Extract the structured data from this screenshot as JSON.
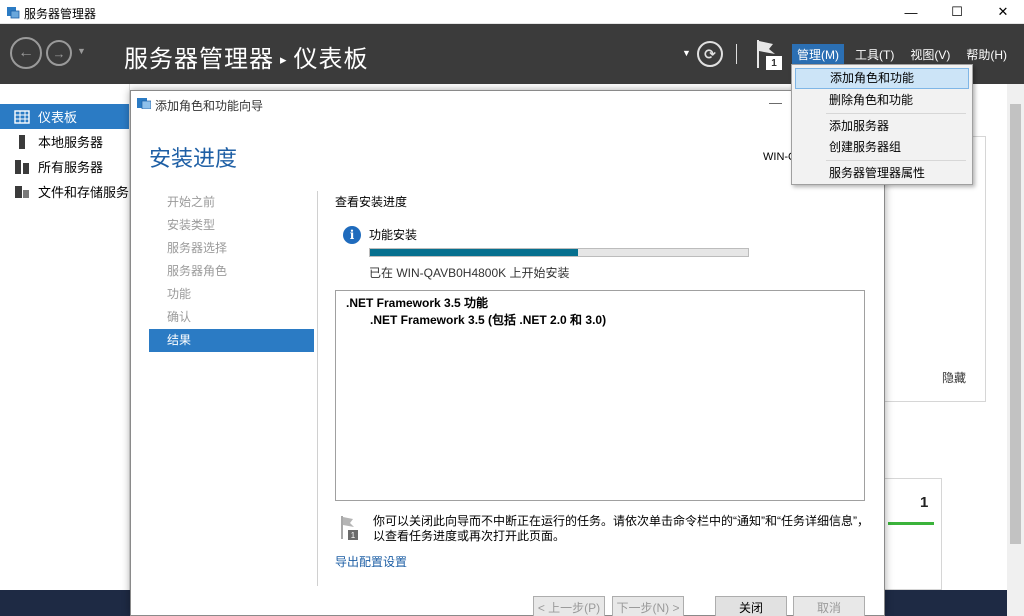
{
  "window": {
    "title": "服务器管理器",
    "minimize_glyph": "—",
    "maximize_glyph": "☐",
    "close_glyph": "✕"
  },
  "header": {
    "breadcrumb_root": "服务器管理器",
    "breadcrumb_sep": "▸",
    "breadcrumb_page": "仪表板",
    "flag_badge": "1",
    "menus": [
      {
        "label": "管理(M)",
        "active": true
      },
      {
        "label": "工具(T)",
        "active": false
      },
      {
        "label": "视图(V)",
        "active": false
      },
      {
        "label": "帮助(H)",
        "active": false
      }
    ]
  },
  "sidebar": {
    "items": [
      {
        "label": "仪表板",
        "icon": "dashboard-icon",
        "selected": true
      },
      {
        "label": "本地服务器",
        "icon": "server-icon",
        "selected": false
      },
      {
        "label": "所有服务器",
        "icon": "servers-icon",
        "selected": false
      },
      {
        "label": "文件和存储服务",
        "icon": "storage-icon",
        "selected": false
      }
    ]
  },
  "background": {
    "hide_label": "隐藏",
    "tile_count": "1"
  },
  "dropdown": {
    "items": [
      {
        "label": "添加角色和功能",
        "highlighted": true
      },
      {
        "label": "删除角色和功能",
        "highlighted": false
      },
      {
        "label": "添加服务器",
        "highlighted": false
      },
      {
        "label": "创建服务器组",
        "highlighted": false
      },
      {
        "label": "服务器管理器属性",
        "highlighted": false
      }
    ]
  },
  "wizard": {
    "title": "添加角色和功能向导",
    "minimize_glyph": "—",
    "heading": "安装进度",
    "target_server": "WIN-Q",
    "steps": [
      {
        "label": "开始之前",
        "current": false
      },
      {
        "label": "安装类型",
        "current": false
      },
      {
        "label": "服务器选择",
        "current": false
      },
      {
        "label": "服务器角色",
        "current": false
      },
      {
        "label": "功能",
        "current": false
      },
      {
        "label": "确认",
        "current": false
      },
      {
        "label": "结果",
        "current": true
      }
    ],
    "section_title": "查看安装进度",
    "feature_install_label": "功能安装",
    "progress": 0.55,
    "status_text": "已在 WIN-QAVB0H4800K 上开始安装",
    "results": [
      ".NET Framework 3.5 功能",
      ".NET Framework 3.5 (包括 .NET 2.0 和 3.0)"
    ],
    "note": "你可以关闭此向导而不中断正在运行的任务。请依次单击命令栏中的“通知”和“任务详细信息”，以查看任务进度或再次打开此页面。",
    "export_link": "导出配置设置",
    "buttons": {
      "prev": "< 上一步(P)",
      "next": "下一步(N) >",
      "close": "关闭",
      "cancel": "取消"
    }
  },
  "colors": {
    "header_bg": "#3b3b3b",
    "accent": "#2b7bc4",
    "progress_fill": "#06708f",
    "heading": "#1e5fa5"
  }
}
